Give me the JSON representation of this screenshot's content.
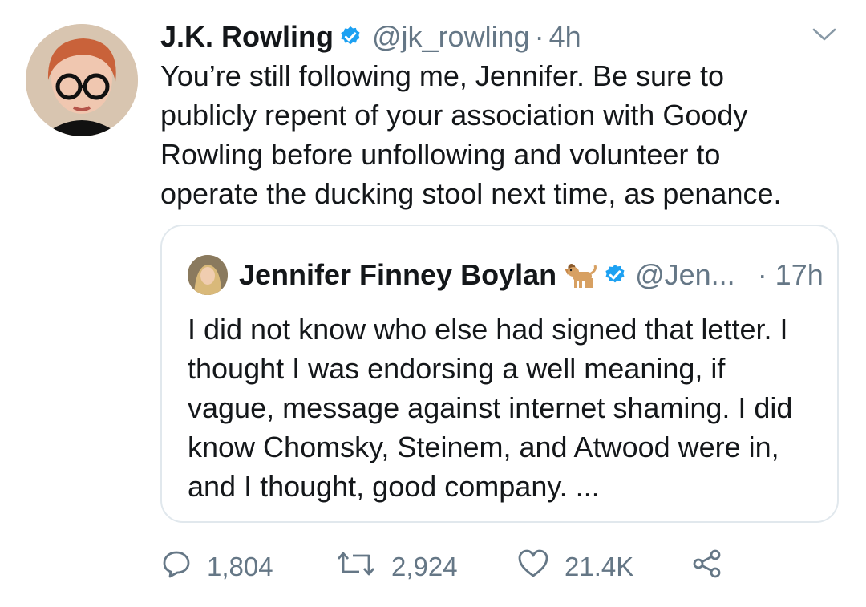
{
  "tweet": {
    "author_name": "J.K. Rowling",
    "author_handle": "@jk_rowling",
    "separator": "·",
    "time": "4h",
    "text": "You’re still following me, Jennifer. Be sure to publicly repent of your association with Goody Rowling before unfollowing and volunteer to operate the ducking stool next time, as penance.",
    "icons": {
      "avatar": "profile-photo",
      "verified": "verified-badge-icon",
      "menu": "chevron-down-icon"
    }
  },
  "quoted_tweet": {
    "author_name": "Jennifer Finney Boylan",
    "author_handle": "@Jen...",
    "time": "· 17h",
    "text": "I did not know who else had signed that letter.  I\nthought I was endorsing a well meaning, if\nvague, message against internet shaming.  I did\nknow Chomsky, Steinem, and Atwood were in,\nand I thought, good company.  ...",
    "icons": {
      "avatar": "profile-photo",
      "emoji": "dog-emoji-icon",
      "verified": "verified-badge-icon"
    }
  },
  "actions": {
    "reply_count": "1,804",
    "retweet_count": "2,924",
    "like_count": "21.4K",
    "icons": [
      "reply-icon",
      "retweet-icon",
      "like-icon",
      "share-icon"
    ]
  },
  "colors": {
    "text": "#14171a",
    "secondary": "#657786",
    "verified": "#1da1f2",
    "border": "#e1e8ed"
  }
}
